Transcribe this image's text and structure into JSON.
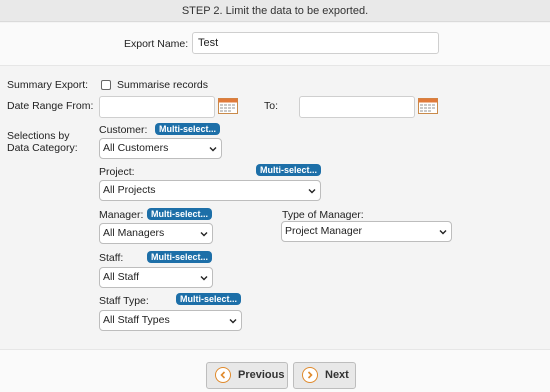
{
  "header": {
    "title": "STEP 2. Limit the data to be exported."
  },
  "export": {
    "label": "Export Name:",
    "value": "Test"
  },
  "summary": {
    "label": "Summary Export:",
    "checkbox_label": "Summarise records",
    "checked": false
  },
  "date_range": {
    "from_label": "Date Range From:",
    "to_label": "To:",
    "from_value": "",
    "to_value": ""
  },
  "selections": {
    "label_line1": "Selections by",
    "label_line2": "Data Category:"
  },
  "multi_select_label": "Multi-select...",
  "customer": {
    "label": "Customer:",
    "selected": "All Customers"
  },
  "project": {
    "label": "Project:",
    "selected": "All Projects"
  },
  "manager": {
    "label": "Manager:",
    "selected": "All Managers"
  },
  "type_of_manager": {
    "label": "Type of Manager:",
    "selected": "Project Manager"
  },
  "staff": {
    "label": "Staff:",
    "selected": "All Staff"
  },
  "staff_type": {
    "label": "Staff Type:",
    "selected": "All Staff Types"
  },
  "buttons": {
    "previous": "Previous",
    "next": "Next"
  },
  "colors": {
    "pill": "#1d6fa8",
    "button_accent": "#e08a2c"
  }
}
